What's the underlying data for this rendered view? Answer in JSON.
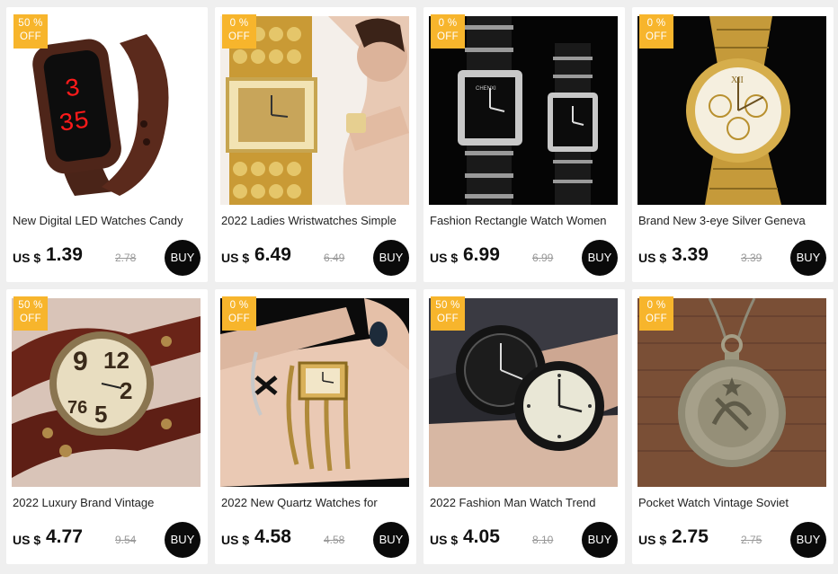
{
  "products": [
    {
      "title": "New Digital LED Watches Candy",
      "currency": "US $",
      "price": "1.39",
      "original_price": "2.78",
      "discount_top": "50 %",
      "discount_bottom": "OFF",
      "buy_label": "BUY",
      "image": "brown-led-watch"
    },
    {
      "title": "2022 Ladies Wristwatches Simple",
      "currency": "US $",
      "price": "6.49",
      "original_price": "6.49",
      "discount_top": "0 %",
      "discount_bottom": "OFF",
      "buy_label": "BUY",
      "image": "gold-crystal-watch"
    },
    {
      "title": "Fashion Rectangle Watch Women",
      "currency": "US $",
      "price": "6.99",
      "original_price": "6.99",
      "discount_top": "0 %",
      "discount_bottom": "OFF",
      "buy_label": "BUY",
      "image": "black-silver-rectangle-watches"
    },
    {
      "title": "Brand New 3-eye Silver Geneva",
      "currency": "US $",
      "price": "3.39",
      "original_price": "3.39",
      "discount_top": "0 %",
      "discount_bottom": "OFF",
      "buy_label": "BUY",
      "image": "gold-geneva-watch"
    },
    {
      "title": "2022 Luxury Brand Vintage",
      "currency": "US $",
      "price": "4.77",
      "original_price": "9.54",
      "discount_top": "50 %",
      "discount_bottom": "OFF",
      "buy_label": "BUY",
      "image": "vintage-leather-watch"
    },
    {
      "title": "2022 New Quartz Watches for",
      "currency": "US $",
      "price": "4.58",
      "original_price": "4.58",
      "discount_top": "0 %",
      "discount_bottom": "OFF",
      "buy_label": "BUY",
      "image": "gold-bangle-watch"
    },
    {
      "title": "2022 Fashion Man Watch Trend",
      "currency": "US $",
      "price": "4.05",
      "original_price": "8.10",
      "discount_top": "50 %",
      "discount_bottom": "OFF",
      "buy_label": "BUY",
      "image": "black-big-dial-watches"
    },
    {
      "title": "Pocket Watch Vintage Soviet",
      "currency": "US $",
      "price": "2.75",
      "original_price": "2.75",
      "discount_top": "0 %",
      "discount_bottom": "OFF",
      "buy_label": "BUY",
      "image": "soviet-pocket-watch"
    }
  ],
  "colors": {
    "badge": "#f7b52c",
    "buy_button": "#0a0a0a",
    "background": "#efefef"
  }
}
